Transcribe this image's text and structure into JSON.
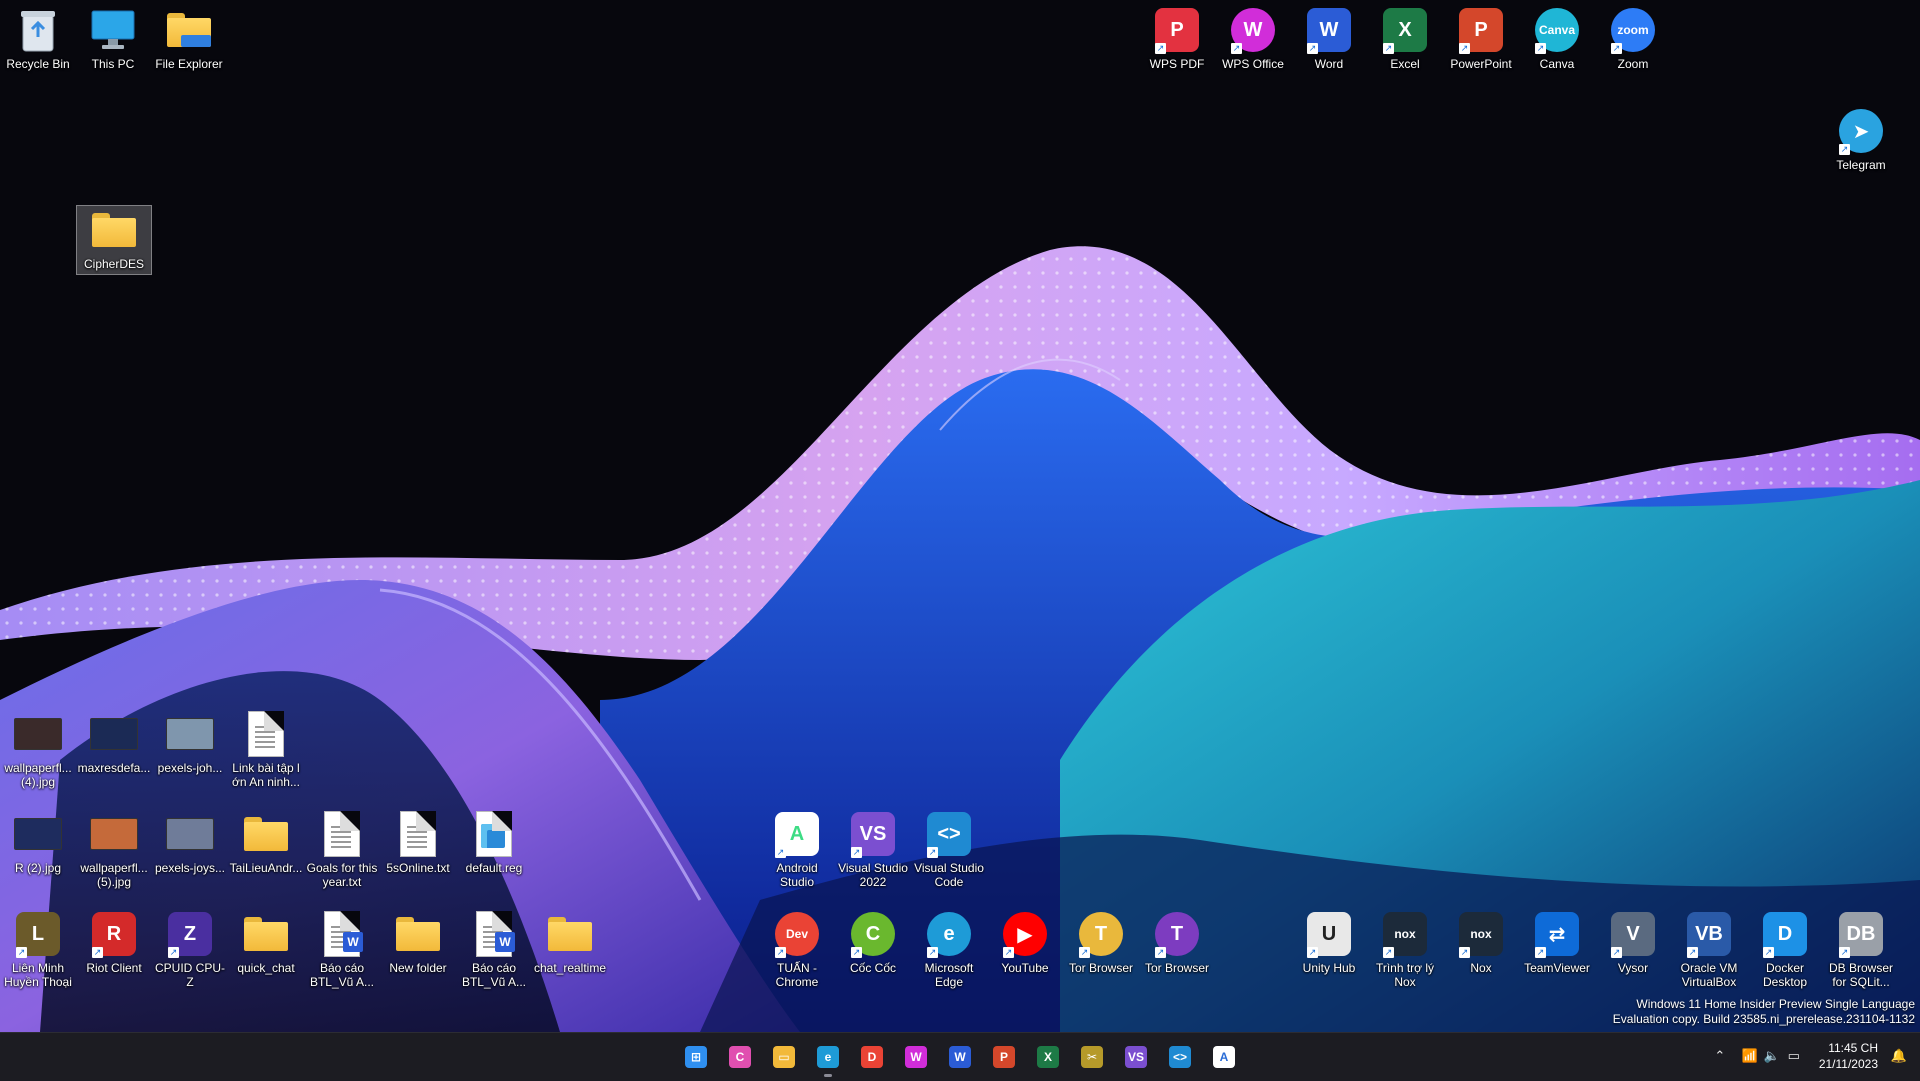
{
  "desktop": {
    "top_left": [
      {
        "name": "Recycle Bin",
        "kind": "recycle"
      },
      {
        "name": "This PC",
        "kind": "pc"
      },
      {
        "name": "File Explorer",
        "kind": "folder"
      }
    ],
    "selected_folder": {
      "name": "CipherDES"
    },
    "top_right": [
      {
        "name": "WPS PDF",
        "bg": "#e33240",
        "glyph": "P"
      },
      {
        "name": "WPS Office",
        "bg": "#d12dd9",
        "glyph": "W"
      },
      {
        "name": "Word",
        "bg": "#2b5cd6",
        "glyph": "W"
      },
      {
        "name": "Excel",
        "bg": "#1d7a46",
        "glyph": "X"
      },
      {
        "name": "PowerPoint",
        "bg": "#d4472b",
        "glyph": "P"
      },
      {
        "name": "Canva",
        "bg": "#1fb6d6",
        "glyph": "Canva"
      },
      {
        "name": "Zoom",
        "bg": "#2d7cf6",
        "glyph": "zoom"
      }
    ],
    "telegram": {
      "name": "Telegram",
      "bg": "#2aa3e0"
    },
    "row_files_1": [
      {
        "name": "wallpaperfl...\n(4).jpg",
        "kind": "thumb",
        "color": "#3a2a2a"
      },
      {
        "name": "maxresdefa...",
        "kind": "thumb",
        "color": "#1b2a55"
      },
      {
        "name": "pexels-joh...",
        "kind": "thumb",
        "color": "#7f96ad"
      },
      {
        "name": "Link bài tập l\nớn An ninh...",
        "kind": "doc"
      }
    ],
    "row_files_2": [
      {
        "name": "R (2).jpg",
        "kind": "thumb",
        "color": "#1e2c5e"
      },
      {
        "name": "wallpaperfl...\n(5).jpg",
        "kind": "thumb",
        "color": "#c56a3a"
      },
      {
        "name": "pexels-joys...",
        "kind": "thumb",
        "color": "#6f7c99"
      },
      {
        "name": "TaiLieuAndr...",
        "kind": "folder"
      },
      {
        "name": "Goals for this\nyear.txt",
        "kind": "doc"
      },
      {
        "name": "5sOnline.txt",
        "kind": "doc"
      },
      {
        "name": "default.reg",
        "kind": "reg"
      }
    ],
    "row_files_3": [
      {
        "name": "Liên Minh\nHuyền Thoại",
        "kind": "tile",
        "bg": "#6b5a2a",
        "glyph": "L"
      },
      {
        "name": "Riot Client",
        "kind": "tile",
        "bg": "#d42a2a",
        "glyph": "R"
      },
      {
        "name": "CPUID CPU-Z",
        "kind": "tile",
        "bg": "#4a2fa0",
        "glyph": "Z"
      },
      {
        "name": "quick_chat",
        "kind": "folder"
      },
      {
        "name": "Báo cáo\nBTL_Vũ A...",
        "kind": "word"
      },
      {
        "name": "New folder",
        "kind": "folder"
      },
      {
        "name": "Báo cáo\nBTL_Vũ A...",
        "kind": "word"
      },
      {
        "name": "chat_realtime",
        "kind": "folder"
      }
    ],
    "middle_upper": [
      {
        "name": "Android\nStudio",
        "bg": "#ffffff",
        "glyph": "A",
        "fg": "#3ddc84"
      },
      {
        "name": "Visual Studio\n2022",
        "bg": "#7b4fd0",
        "glyph": "VS"
      },
      {
        "name": "Visual Studio\nCode",
        "bg": "#1f8ad2",
        "glyph": "<>"
      }
    ],
    "middle_lower": [
      {
        "name": "TUẤN -\nChrome",
        "bg": "#ea4335",
        "glyph": "Dev"
      },
      {
        "name": "Cốc Cốc",
        "bg": "#6ab82e",
        "glyph": "C"
      },
      {
        "name": "Microsoft\nEdge",
        "bg": "#1e9bd7",
        "glyph": "e"
      },
      {
        "name": "YouTube",
        "bg": "#ff0000",
        "glyph": "▶"
      },
      {
        "name": "Tor Browser",
        "bg": "#e9b83c",
        "glyph": "T"
      },
      {
        "name": "Tor Browser",
        "bg": "#7d3cc0",
        "glyph": "T"
      }
    ],
    "right_bottom": [
      {
        "name": "Unity Hub",
        "bg": "#e8e8e8",
        "glyph": "U",
        "fg": "#222"
      },
      {
        "name": "Trình trợ lý\nNox",
        "bg": "#1c2a3a",
        "glyph": "nox"
      },
      {
        "name": "Nox",
        "bg": "#1c2a3a",
        "glyph": "nox"
      },
      {
        "name": "TeamViewer",
        "bg": "#0e6bd8",
        "glyph": "⇄"
      },
      {
        "name": "Vysor",
        "bg": "#5a6a80",
        "glyph": "V"
      },
      {
        "name": "Oracle VM\nVirtualBox",
        "bg": "#2a5aa8",
        "glyph": "VB"
      },
      {
        "name": "Docker\nDesktop",
        "bg": "#1d91e6",
        "glyph": "D"
      },
      {
        "name": "DB Browser\nfor SQLit...",
        "bg": "#9aa0a8",
        "glyph": "DB"
      }
    ]
  },
  "watermark": {
    "line1": "Windows 11 Home Insider Preview Single Language",
    "line2": "Evaluation copy. Build 23585.ni_prerelease.231104-1132"
  },
  "taskbar": {
    "apps": [
      {
        "name": "start-icon",
        "bg": "#2f8ff0",
        "glyph": "⊞"
      },
      {
        "name": "copilot-icon",
        "bg": "#e04fb0",
        "glyph": "C"
      },
      {
        "name": "file-explorer-icon",
        "bg": "#f2b93a",
        "glyph": "▭"
      },
      {
        "name": "edge-icon",
        "bg": "#1e9bd7",
        "glyph": "e"
      },
      {
        "name": "chrome-dev-icon",
        "bg": "#ea4335",
        "glyph": "D"
      },
      {
        "name": "wps-office-icon",
        "bg": "#d12dd9",
        "glyph": "W"
      },
      {
        "name": "word-icon",
        "bg": "#2b5cd6",
        "glyph": "W"
      },
      {
        "name": "powerpoint-icon",
        "bg": "#d4472b",
        "glyph": "P"
      },
      {
        "name": "excel-icon",
        "bg": "#1d7a46",
        "glyph": "X"
      },
      {
        "name": "snipping-icon",
        "bg": "#b69a2a",
        "glyph": "✂"
      },
      {
        "name": "visual-studio-icon",
        "bg": "#7b4fd0",
        "glyph": "VS"
      },
      {
        "name": "vscode-icon",
        "bg": "#1f8ad2",
        "glyph": "<>"
      },
      {
        "name": "android-studio-icon",
        "bg": "#ffffff",
        "glyph": "A"
      }
    ],
    "time": "11:45 CH",
    "date": "21/11/2023"
  }
}
